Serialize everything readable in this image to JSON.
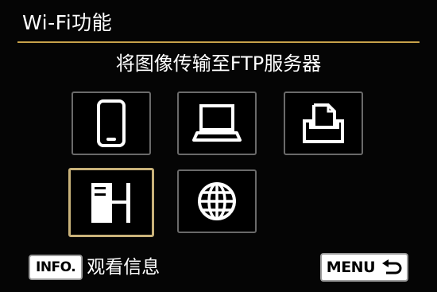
{
  "header": {
    "title": "Wi-Fi功能"
  },
  "subtitle": "将图像传输至FTP服务器",
  "tiles": [
    {
      "icon": "smartphone-icon",
      "selected": false
    },
    {
      "icon": "computer-icon",
      "selected": false
    },
    {
      "icon": "printer-icon",
      "selected": false
    },
    {
      "icon": "ftp-server-icon",
      "selected": true
    },
    {
      "icon": "globe-icon",
      "selected": false
    }
  ],
  "footer": {
    "info_key": "INFO.",
    "info_label": "观看信息",
    "menu_key": "MENU",
    "menu_icon": "back-arrow-icon"
  },
  "colors": {
    "background": "#000000",
    "accent_rule": "#c8a24a",
    "selection": "#c9b27a",
    "tile_border": "#6a6a6a"
  }
}
